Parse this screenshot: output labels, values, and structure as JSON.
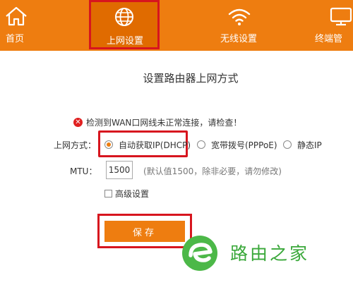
{
  "nav": {
    "items": [
      {
        "label": "首页",
        "icon": "home-icon"
      },
      {
        "label": "上网设置",
        "icon": "globe-icon",
        "active": true
      },
      {
        "label": "无线设置",
        "icon": "wifi-icon"
      },
      {
        "label": "终端管",
        "icon": "monitor-icon"
      }
    ]
  },
  "page": {
    "title": "设置路由器上网方式"
  },
  "warning": {
    "text": "检测到WAN口网线未正常连接，请检查！"
  },
  "connection": {
    "label": "上网方式：",
    "options": [
      {
        "label": "自动获取IP(DHCP)",
        "selected": true
      },
      {
        "label": "宽带拨号(PPPoE)",
        "selected": false
      },
      {
        "label": "静态IP",
        "selected": false
      }
    ]
  },
  "mtu": {
    "label": "MTU：",
    "value": "1500",
    "hint": "(默认值1500，除非必要，请勿修改)"
  },
  "advanced": {
    "label": "高级设置",
    "checked": false
  },
  "actions": {
    "save_label": "保存"
  },
  "watermark": {
    "text": "路由之家"
  },
  "colors": {
    "accent": "#ee7d10",
    "highlight": "#d7151e",
    "watermark": "#3aa83a"
  }
}
